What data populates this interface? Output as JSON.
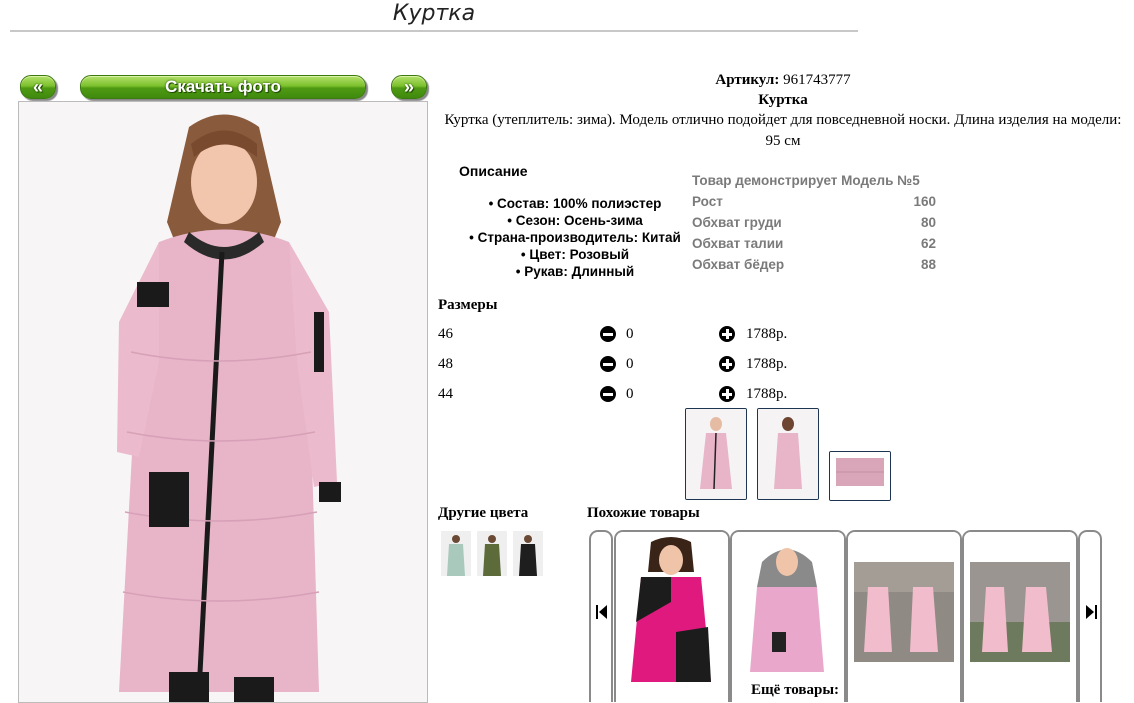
{
  "page": {
    "title": "Куртка"
  },
  "controls": {
    "prev_label": "«",
    "download_label": "Скачать фото",
    "next_label": "»"
  },
  "product": {
    "sku_label": "Артикул:",
    "sku_value": "961743777",
    "name": "Куртка",
    "description": "Куртка (утеплитель: зима). Модель отлично подойдет для повседневной носки. Длина изделия на модели: 95 см"
  },
  "specs": {
    "title": "Описание",
    "items": [
      "• Состав: 100% полиэстер",
      "• Сезон: Осень-зима",
      "• Страна-производитель: Китай",
      "• Цвет: Розовый",
      "• Рукав: Длинный"
    ]
  },
  "model": {
    "title": "Товар демонстрирует Модель №5",
    "rows": [
      {
        "label": "Рост",
        "value": "160"
      },
      {
        "label": "Обхват груди",
        "value": "80"
      },
      {
        "label": "Обхват талии",
        "value": "62"
      },
      {
        "label": "Обхват бёдер",
        "value": "88"
      }
    ]
  },
  "sizes": {
    "title": "Размеры",
    "rows": [
      {
        "size": "46",
        "qty": "0",
        "price": "1788р."
      },
      {
        "size": "48",
        "qty": "0",
        "price": "1788р."
      },
      {
        "size": "44",
        "qty": "0",
        "price": "1788р."
      }
    ]
  },
  "other_colors": {
    "title": "Другие цвета",
    "swatches": [
      "mint",
      "olive",
      "black"
    ]
  },
  "similar": {
    "title": "Похожие товары"
  },
  "more": {
    "label": "Ещё товары:"
  },
  "colors": {
    "button_green": "#6cb224",
    "product_pink": "#e8b4c8",
    "thumb_border": "#1d3550"
  }
}
